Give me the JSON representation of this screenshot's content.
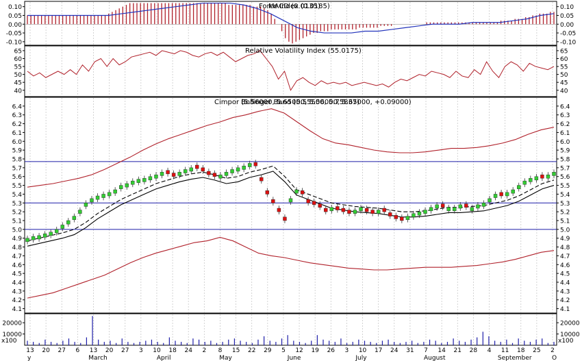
{
  "chart_data": [
    {
      "type": "bar",
      "panel": "force_index",
      "title": "Force Index (0.0185)",
      "overlay_title": "MACD (0.0135)",
      "ylim": [
        -0.12,
        0.13
      ],
      "y_ticks": [
        0.1,
        0.05,
        0.0,
        -0.05,
        -0.1
      ],
      "y_tick_labels": [
        "0.10",
        "0.05",
        "0.00",
        "-0.05",
        "-0.10"
      ],
      "series": [
        {
          "name": "Force Index",
          "color": "#b0202a",
          "values": [
            0.05,
            0.05,
            0.05,
            0.05,
            0.05,
            0.05,
            0.05,
            0.05,
            0.05,
            0.05,
            0.05,
            0.05,
            0.05,
            0.05,
            0.05,
            0.05,
            0.05,
            0.05,
            0.05,
            0.05,
            0.05,
            0.05,
            0.05,
            0.06,
            0.07,
            0.08,
            0.09,
            0.1,
            0.11,
            0.12,
            0.12,
            0.12,
            0.12,
            0.12,
            0.12,
            0.12,
            0.12,
            0.12,
            0.12,
            0.12,
            0.12,
            0.12,
            0.12,
            0.12,
            0.12,
            0.12,
            0.12,
            0.12,
            0.12,
            0.12,
            0.12,
            0.12,
            0.12,
            0.12,
            0.12,
            0.12,
            0.12,
            0.11,
            0.11,
            0.11,
            0.11,
            0.11,
            0.11,
            0.11,
            0.1,
            0.1,
            0.1,
            0.09,
            0.08,
            0.06,
            0.03,
            0.0,
            -0.04,
            -0.08,
            -0.1,
            -0.11,
            -0.1,
            -0.09,
            -0.08,
            -0.07,
            -0.06,
            -0.05,
            -0.05,
            -0.04,
            -0.04,
            -0.04,
            -0.03,
            -0.03,
            -0.03,
            -0.03,
            -0.03,
            -0.03,
            -0.03,
            -0.03,
            -0.02,
            -0.02,
            -0.02,
            -0.02,
            -0.02,
            -0.02,
            -0.01,
            -0.01,
            -0.01,
            -0.01,
            0.0,
            0.0,
            0.0,
            0.0,
            0.0,
            0.0,
            0.0,
            0.0,
            0.0,
            0.01,
            0.01,
            0.01,
            0.01,
            0.01,
            0.01,
            0.01,
            0.01,
            0.01,
            0.01,
            0.01,
            0.01,
            0.01,
            0.01,
            0.01,
            0.01,
            0.01,
            0.01,
            0.01,
            0.01,
            0.01,
            0.02,
            0.02,
            0.02,
            0.02,
            0.03,
            0.03,
            0.03,
            0.04,
            0.04,
            0.05,
            0.05,
            0.06,
            0.06,
            0.06,
            0.07,
            0.07
          ]
        },
        {
          "name": "MACD",
          "color": "#2233bb",
          "values": [
            0.05,
            0.05,
            0.05,
            0.05,
            0.05,
            0.05,
            0.05,
            0.06,
            0.07,
            0.08,
            0.09,
            0.1,
            0.11,
            0.12,
            0.12,
            0.12,
            0.11,
            0.09,
            0.06,
            0.02,
            -0.02,
            -0.04,
            -0.05,
            -0.05,
            -0.05,
            -0.04,
            -0.04,
            -0.03,
            -0.02,
            -0.01,
            0.0,
            0.0,
            0.0,
            0.01,
            0.01,
            0.01,
            0.02,
            0.03,
            0.05,
            0.06
          ]
        }
      ]
    },
    {
      "type": "line",
      "panel": "rvi",
      "title": "Relative Volatility Index (55.0175)",
      "ylim": [
        36,
        68
      ],
      "y_ticks": [
        65,
        60,
        55,
        50,
        45,
        40
      ],
      "y_tick_labels": [
        "65",
        "60",
        "55",
        "50",
        "45",
        "40"
      ],
      "series": [
        {
          "name": "Relative Volatility Index",
          "color": "#b0202a",
          "values": [
            52,
            49,
            51,
            48,
            50,
            52,
            50,
            53,
            50,
            56,
            52,
            58,
            60,
            55,
            60,
            56,
            58,
            61,
            62,
            63,
            64,
            62,
            65,
            64,
            63,
            65,
            64,
            62,
            61,
            63,
            64,
            62,
            64,
            61,
            58,
            60,
            62,
            63,
            65,
            60,
            55,
            47,
            52,
            40,
            46,
            48,
            45,
            43,
            46,
            44,
            45,
            44,
            45,
            43,
            44,
            45,
            44,
            43,
            44,
            42,
            45,
            47,
            46,
            48,
            50,
            49,
            52,
            51,
            50,
            48,
            52,
            49,
            48,
            53,
            50,
            58,
            52,
            48,
            55,
            58,
            56,
            52,
            57,
            55,
            54,
            53,
            55
          ]
        }
      ]
    },
    {
      "type": "candlestick",
      "panel": "price",
      "title": "Cimpor (5.56000, 5.65000, 5.56000, 5.65000, +0.09000)",
      "overlay_title": "Bollinger Band (5.55500, 5.75837)",
      "ylim": [
        4.05,
        6.5
      ],
      "y_ticks": [
        6.4,
        6.3,
        6.2,
        6.1,
        6.0,
        5.9,
        5.8,
        5.7,
        5.6,
        5.5,
        5.4,
        5.3,
        5.2,
        5.1,
        5.0,
        4.9,
        4.8,
        4.7,
        4.6,
        4.5,
        4.4,
        4.3,
        4.2,
        4.1
      ],
      "y_tick_labels": [
        "6.4",
        "6.3",
        "6.2",
        "6.1",
        "6.0",
        "5.9",
        "5.8",
        "5.7",
        "5.6",
        "5.5",
        "5.4",
        "5.3",
        "5.2",
        "5.1",
        "5.0",
        "4.9",
        "4.8",
        "4.7",
        "4.6",
        "4.5",
        "4.4",
        "4.3",
        "4.2",
        "4.1"
      ],
      "horizontal_lines": [
        5.77,
        5.3,
        5.0
      ],
      "close": [
        4.9,
        4.92,
        4.93,
        4.95,
        4.97,
        5.0,
        5.05,
        5.1,
        5.15,
        5.22,
        5.3,
        5.35,
        5.38,
        5.4,
        5.42,
        5.45,
        5.5,
        5.52,
        5.55,
        5.57,
        5.58,
        5.6,
        5.62,
        5.65,
        5.63,
        5.6,
        5.65,
        5.68,
        5.7,
        5.69,
        5.66,
        5.62,
        5.6,
        5.62,
        5.65,
        5.68,
        5.7,
        5.72,
        5.75,
        5.72,
        5.55,
        5.4,
        5.3,
        5.2,
        5.1,
        5.35,
        5.45,
        5.4,
        5.3,
        5.28,
        5.25,
        5.2,
        5.25,
        5.22,
        5.2,
        5.18,
        5.22,
        5.25,
        5.2,
        5.18,
        5.22,
        5.2,
        5.15,
        5.12,
        5.1,
        5.15,
        5.18,
        5.2,
        5.22,
        5.25,
        5.28,
        5.25,
        5.25,
        5.25,
        5.28,
        5.25,
        5.25,
        5.28,
        5.3,
        5.35,
        5.4,
        5.38,
        5.42,
        5.45,
        5.5,
        5.55,
        5.58,
        5.6,
        5.58,
        5.62,
        5.65
      ],
      "bollinger_upper": [
        5.48,
        5.5,
        5.52,
        5.55,
        5.58,
        5.62,
        5.68,
        5.75,
        5.82,
        5.9,
        5.97,
        6.03,
        6.08,
        6.13,
        6.18,
        6.22,
        6.27,
        6.3,
        6.34,
        6.37,
        6.32,
        6.22,
        6.12,
        6.03,
        5.98,
        5.96,
        5.93,
        5.9,
        5.88,
        5.87,
        5.87,
        5.88,
        5.9,
        5.92,
        5.92,
        5.93,
        5.95,
        5.98,
        6.02,
        6.08,
        6.13,
        6.16
      ],
      "bollinger_lower": [
        4.22,
        4.25,
        4.28,
        4.33,
        4.38,
        4.43,
        4.48,
        4.55,
        4.62,
        4.68,
        4.73,
        4.77,
        4.81,
        4.85,
        4.87,
        4.91,
        4.87,
        4.8,
        4.73,
        4.7,
        4.68,
        4.65,
        4.62,
        4.6,
        4.58,
        4.56,
        4.55,
        4.54,
        4.54,
        4.55,
        4.56,
        4.57,
        4.57,
        4.57,
        4.58,
        4.59,
        4.61,
        4.63,
        4.66,
        4.7,
        4.74,
        4.76
      ],
      "moving_average": [
        4.87,
        4.9,
        4.93,
        4.96,
        5.0,
        5.08,
        5.18,
        5.26,
        5.34,
        5.4,
        5.46,
        5.52,
        5.56,
        5.6,
        5.63,
        5.65,
        5.62,
        5.58,
        5.6,
        5.65,
        5.68,
        5.72,
        5.6,
        5.45,
        5.4,
        5.35,
        5.3,
        5.28,
        5.26,
        5.25,
        5.24,
        5.22,
        5.2,
        5.2,
        5.21,
        5.23,
        5.25,
        5.25,
        5.26,
        5.27,
        5.3,
        5.33,
        5.38,
        5.45,
        5.52,
        5.56
      ]
    },
    {
      "type": "bar",
      "panel": "volume",
      "ylim": [
        0,
        28000
      ],
      "y_ticks": [
        20000,
        10000
      ],
      "y_tick_labels": [
        "20000",
        "10000"
      ],
      "unit_label": "x100",
      "values": [
        4000,
        3000,
        2000,
        5000,
        3000,
        2000,
        4000,
        6000,
        3000,
        2000,
        7000,
        26000,
        5000,
        3000,
        4000,
        2000,
        6000,
        3000,
        2000,
        3000,
        4000,
        5000,
        3000,
        2000,
        7000,
        4000,
        3000,
        2000,
        6000,
        5000,
        3000,
        4000,
        2000,
        3000,
        5000,
        6000,
        4000,
        3000,
        2000,
        5000,
        8000,
        4000,
        3000,
        6000,
        9000,
        4000,
        3000,
        2000,
        4000,
        9000,
        5000,
        4000,
        3000,
        6000,
        2000,
        3000,
        5000,
        4000,
        3000,
        2000,
        4000,
        5000,
        3000,
        2000,
        3000,
        4000,
        2000,
        3000,
        5000,
        4000,
        2000,
        3000,
        6000,
        4000,
        3000,
        5000,
        7000,
        12000,
        8000,
        4000,
        3000,
        5000,
        2000,
        6000,
        4000,
        3000,
        5000,
        6000,
        2000,
        3000
      ]
    }
  ],
  "x_axis": {
    "tick_labels": [
      "13",
      "20",
      "27",
      "6",
      "13",
      "20",
      "27",
      "3",
      "10",
      "18",
      "24",
      "2",
      "8",
      "15",
      "22",
      "29",
      "5",
      "12",
      "19",
      "26",
      "3",
      "10",
      "17",
      "24",
      "31",
      "7",
      "14",
      "21",
      "28",
      "4",
      "11",
      "18",
      "25",
      "2"
    ],
    "month_labels": [
      "y",
      "March",
      "April",
      "May",
      "June",
      "July",
      "August",
      "September",
      "O"
    ]
  }
}
